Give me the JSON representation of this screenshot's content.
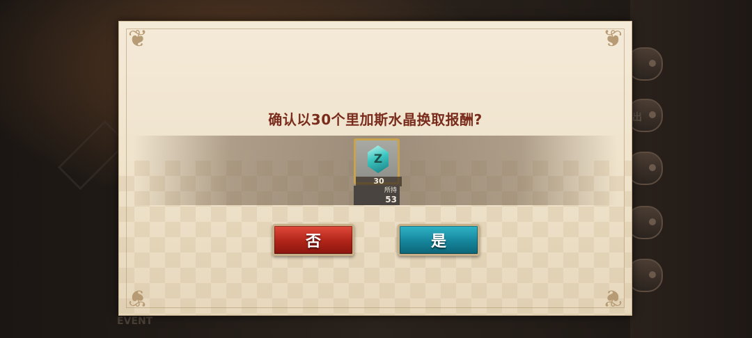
{
  "background": {
    "side_text": "出",
    "event_text": "EVENT"
  },
  "dialog": {
    "title": "确认以30个里加斯水晶换取报酬?",
    "item": {
      "icon": "crystal-icon",
      "glyph": "Z",
      "quantity": "30",
      "owned_label": "所持",
      "owned_value": "53"
    },
    "buttons": {
      "no_label": "否",
      "yes_label": "是"
    }
  },
  "colors": {
    "title": "#7a2c1c",
    "no_button": "#b02419",
    "yes_button": "#15859b",
    "parchment": "#efe3cc"
  }
}
